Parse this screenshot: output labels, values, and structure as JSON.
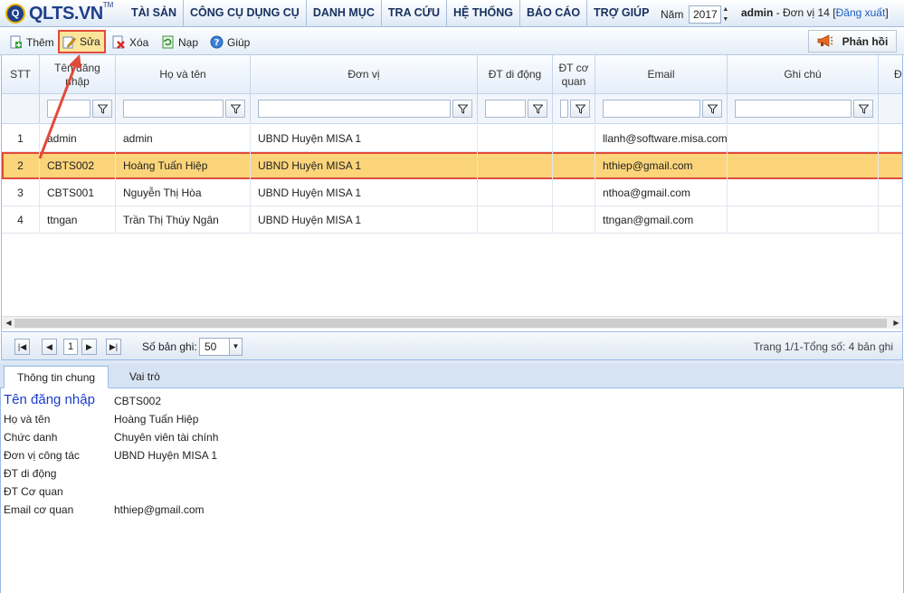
{
  "logo": {
    "badge": "Q",
    "text": "QLTS.VN",
    "tm": "TM"
  },
  "menu": [
    "TÀI SẢN",
    "CÔNG CỤ DỤNG CỤ",
    "DANH MỤC",
    "TRA CỨU",
    "HỆ THỐNG",
    "BÁO CÁO",
    "TRỢ GIÚP"
  ],
  "year": {
    "label": "Năm",
    "value": "2017"
  },
  "user": {
    "name": "admin",
    "unit": "- Đơn vị 14",
    "bracket_open": "[",
    "logout": "Đăng xuất",
    "bracket_close": "]"
  },
  "toolbar": {
    "add": "Thêm",
    "edit": "Sửa",
    "delete": "Xóa",
    "reload": "Nạp",
    "help": "Giúp",
    "feedback": "Phản hồi"
  },
  "columns": [
    "STT",
    "Tên đăng nhập",
    "Họ và tên",
    "Đơn vị",
    "ĐT di động",
    "ĐT cơ quan",
    "Email",
    "Ghi chú",
    "Đ"
  ],
  "rows": [
    {
      "stt": "1",
      "username": "admin",
      "fullname": "admin",
      "unit": "UBND Huyện MISA 1",
      "mobile": "",
      "office": "",
      "email": "llanh@software.misa.com.vn",
      "note": ""
    },
    {
      "stt": "2",
      "username": "CBTS002",
      "fullname": "Hoàng Tuấn Hiệp",
      "unit": "UBND Huyện MISA 1",
      "mobile": "",
      "office": "",
      "email": "hthiep@gmail.com",
      "note": ""
    },
    {
      "stt": "3",
      "username": "CBTS001",
      "fullname": "Nguyễn Thị Hòa",
      "unit": "UBND Huyện MISA 1",
      "mobile": "",
      "office": "",
      "email": "nthoa@gmail.com",
      "note": ""
    },
    {
      "stt": "4",
      "username": "ttngan",
      "fullname": "Trần Thị Thúy Ngân",
      "unit": "UBND Huyện MISA 1",
      "mobile": "",
      "office": "",
      "email": "ttngan@gmail.com",
      "note": ""
    }
  ],
  "selected_row": 1,
  "pager": {
    "page": "1",
    "records_label": "Số bản ghi:",
    "page_size": "50",
    "info": "Trang 1/1-Tổng số: 4 bản ghi"
  },
  "tabs": [
    "Thông tin chung",
    "Vai trò"
  ],
  "detail": [
    {
      "label": "Tên đăng nhập",
      "value": "CBTS002"
    },
    {
      "label": "Họ và tên",
      "value": "Hoàng Tuấn Hiệp"
    },
    {
      "label": "Chức danh",
      "value": "Chuyên viên tài chính"
    },
    {
      "label": "Đơn vị công tác",
      "value": "UBND Huyện MISA 1"
    },
    {
      "label": "ĐT di động",
      "value": ""
    },
    {
      "label": "ĐT Cơ quan",
      "value": ""
    },
    {
      "label": "Email cơ quan",
      "value": "hthiep@gmail.com"
    }
  ],
  "colors": {
    "selected_row": "#fcd57b",
    "highlight": "#e24a3b",
    "header_blue": "#1f3f8a"
  }
}
